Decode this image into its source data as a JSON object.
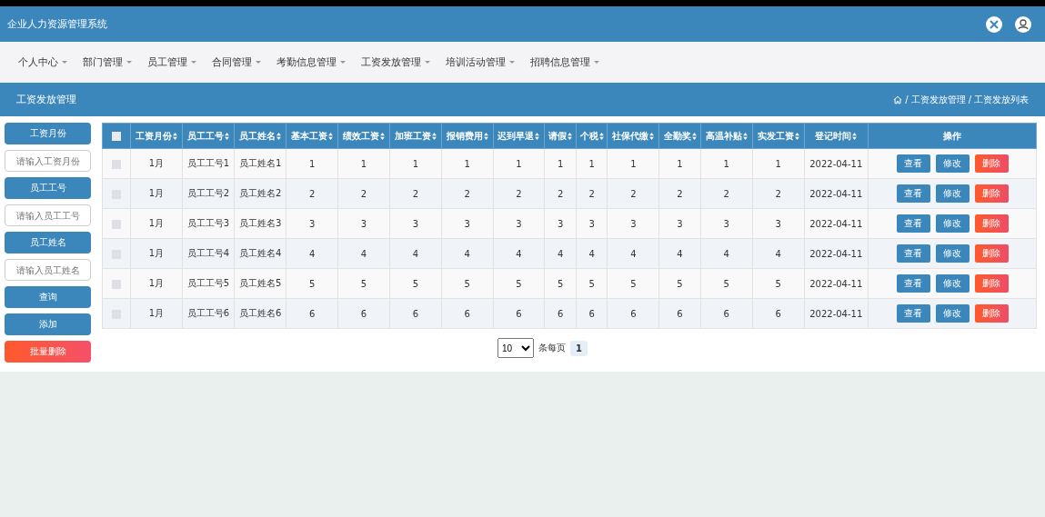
{
  "header": {
    "title": "企业人力资源管理系统"
  },
  "nav": [
    {
      "label": "个人中心"
    },
    {
      "label": "部门管理"
    },
    {
      "label": "员工管理"
    },
    {
      "label": "合同管理"
    },
    {
      "label": "考勤信息管理"
    },
    {
      "label": "工资发放管理"
    },
    {
      "label": "培训活动管理"
    },
    {
      "label": "招聘信息管理"
    }
  ],
  "section": {
    "title": "工资发放管理",
    "breadcrumb": [
      "工资发放管理",
      "工资发放列表"
    ],
    "breadcrumb_separator": "/"
  },
  "filters": [
    {
      "label": "工资月份",
      "placeholder": "请输入工资月份"
    },
    {
      "label": "员工工号",
      "placeholder": "请输入员工工号"
    },
    {
      "label": "员工姓名",
      "placeholder": "请输入员工姓名"
    }
  ],
  "side_buttons": [
    {
      "label": "查询",
      "kind": "primary"
    },
    {
      "label": "添加",
      "kind": "primary"
    },
    {
      "label": "批量删除",
      "kind": "danger"
    }
  ],
  "table": {
    "select_all_checked": false,
    "columns": [
      "工资月份",
      "员工工号",
      "员工姓名",
      "基本工资",
      "绩效工资",
      "加班工资",
      "报销费用",
      "迟到早退",
      "请假",
      "个税",
      "社保代缴",
      "全勤奖",
      "高温补贴",
      "实发工资",
      "登记时间"
    ],
    "action_column": "操作",
    "rows": [
      {
        "checked": false,
        "cells": [
          "1月",
          "员工工号1",
          "员工姓名1",
          "1",
          "1",
          "1",
          "1",
          "1",
          "1",
          "1",
          "1",
          "1",
          "1",
          "1",
          "2022-04-11"
        ],
        "actions": [
          "查看",
          "修改",
          "删除"
        ]
      },
      {
        "checked": false,
        "cells": [
          "1月",
          "员工工号2",
          "员工姓名2",
          "2",
          "2",
          "2",
          "2",
          "2",
          "2",
          "2",
          "2",
          "2",
          "2",
          "2",
          "2022-04-11"
        ],
        "actions": [
          "查看",
          "修改",
          "删除"
        ]
      },
      {
        "checked": false,
        "cells": [
          "1月",
          "员工工号3",
          "员工姓名3",
          "3",
          "3",
          "3",
          "3",
          "3",
          "3",
          "3",
          "3",
          "3",
          "3",
          "3",
          "2022-04-11"
        ],
        "actions": [
          "查看",
          "修改",
          "删除"
        ]
      },
      {
        "checked": false,
        "cells": [
          "1月",
          "员工工号4",
          "员工姓名4",
          "4",
          "4",
          "4",
          "4",
          "4",
          "4",
          "4",
          "4",
          "4",
          "4",
          "4",
          "2022-04-11"
        ],
        "actions": [
          "查看",
          "修改",
          "删除"
        ]
      },
      {
        "checked": false,
        "cells": [
          "1月",
          "员工工号5",
          "员工姓名5",
          "5",
          "5",
          "5",
          "5",
          "5",
          "5",
          "5",
          "5",
          "5",
          "5",
          "5",
          "2022-04-11"
        ],
        "actions": [
          "查看",
          "修改",
          "删除"
        ]
      },
      {
        "checked": false,
        "cells": [
          "1月",
          "员工工号6",
          "员工姓名6",
          "6",
          "6",
          "6",
          "6",
          "6",
          "6",
          "6",
          "6",
          "6",
          "6",
          "6",
          "2022-04-11"
        ],
        "actions": [
          "查看",
          "修改",
          "删除"
        ]
      }
    ]
  },
  "pagination": {
    "page_size": "10",
    "page_size_label": "条每页",
    "pages": [
      {
        "label": "1",
        "selected": true
      }
    ]
  }
}
